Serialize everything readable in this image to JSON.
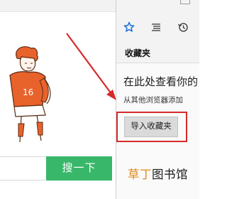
{
  "page": {
    "search_button_label": "搜一下"
  },
  "hub": {
    "tabs": [
      {
        "icon": "star-icon",
        "active": true
      },
      {
        "icon": "reading-list-icon",
        "active": false
      },
      {
        "icon": "history-icon",
        "active": false
      }
    ],
    "title": "收藏夹",
    "heading": "在此处查看你的",
    "subtext": "从其他浏览器添加",
    "import_button_label": "导入收藏夹"
  },
  "watermark": {
    "accent": "草丁",
    "rest": "图书馆"
  },
  "colors": {
    "search_green": "#38b76a",
    "hub_accent": "#1a6fd6",
    "annotation_red": "#d62b2b",
    "figure_orange": "#e8622c"
  }
}
